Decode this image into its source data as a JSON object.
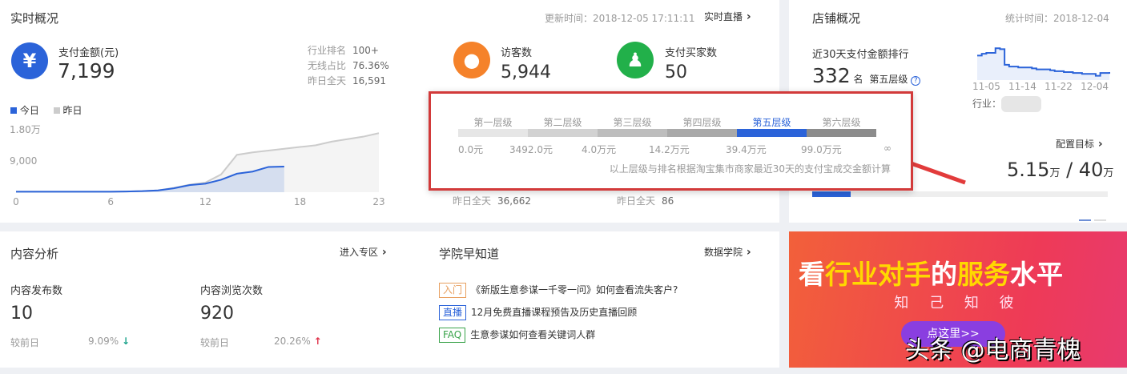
{
  "realtime": {
    "title": "实时概况",
    "update_time": "更新时间：2018-12-05 17:11:11",
    "live_link": "实时直播",
    "pay": {
      "icon": "yen-icon",
      "label": "支付金额(元)",
      "value": "7,199",
      "stats": [
        {
          "k": "行业排名",
          "v": "100+"
        },
        {
          "k": "无线占比",
          "v": "76.36%"
        },
        {
          "k": "昨日全天",
          "v": "16,591"
        }
      ]
    },
    "visitors": {
      "icon": "footprint-icon",
      "label": "访客数",
      "value": "5,944",
      "yesterday_k": "昨日全天",
      "yesterday_v": "36,662"
    },
    "buyers": {
      "icon": "users-icon",
      "label": "支付买家数",
      "value": "50",
      "yesterday_k": "昨日全天",
      "yesterday_v": "86"
    },
    "colors": {
      "blue": "#2b63d9",
      "orange": "#f5822a",
      "green": "#22b04a"
    }
  },
  "chart_data": {
    "type": "area",
    "legend": [
      "今日",
      "昨日"
    ],
    "legend_placement": "top-left",
    "y_ticks": [
      "1.80万",
      "9,000"
    ],
    "x_ticks": [
      "0",
      "6",
      "12",
      "18",
      "23"
    ],
    "ylim": [
      0,
      18000
    ],
    "xlim": [
      0,
      23
    ],
    "series": [
      {
        "name": "今日",
        "color": "#2b63d9",
        "x": [
          0,
          1,
          2,
          3,
          4,
          5,
          6,
          7,
          8,
          9,
          10,
          11,
          12,
          13,
          14,
          15,
          16,
          17
        ],
        "values": [
          150,
          150,
          150,
          150,
          150,
          150,
          150,
          200,
          300,
          500,
          1100,
          2000,
          2400,
          3500,
          5200,
          5800,
          7100,
          7199
        ]
      },
      {
        "name": "昨日",
        "color": "#cccccc",
        "x": [
          0,
          1,
          2,
          3,
          4,
          5,
          6,
          7,
          8,
          9,
          10,
          11,
          12,
          13,
          14,
          15,
          16,
          17,
          18,
          19,
          20,
          21,
          22,
          23
        ],
        "values": [
          150,
          150,
          150,
          150,
          150,
          150,
          150,
          200,
          300,
          500,
          1200,
          2100,
          2700,
          5000,
          10500,
          11200,
          11700,
          12200,
          12700,
          13200,
          14200,
          14900,
          15600,
          16591
        ]
      }
    ]
  },
  "levels": {
    "names": [
      "第一层级",
      "第二层级",
      "第三层级",
      "第四层级",
      "第五层级",
      "第六层级"
    ],
    "current": "第五层级",
    "thresholds": [
      "0.0元",
      "3492.0元",
      "4.0万元",
      "14.2万元",
      "39.4万元",
      "99.0万元",
      "∞"
    ],
    "note": "以上层级与排名根据淘宝集市商家最近30天的支付宝成交金额计算"
  },
  "store": {
    "title": "店铺概况",
    "stat_time": "统计时间：2018-12-04",
    "rank_label": "近30天支付金额排行",
    "rank": "332",
    "rank_unit": "名",
    "level": "第五层级",
    "help_icon": "question-icon",
    "spark_x": [
      "11-05",
      "11-14",
      "11-22",
      "12-04"
    ],
    "spark_values": [
      60,
      58,
      57,
      57,
      52,
      53,
      70,
      72,
      72,
      73,
      73,
      73,
      74,
      75,
      75,
      75,
      76,
      77,
      77,
      78,
      78,
      79,
      79,
      80,
      80,
      80,
      82,
      79,
      79,
      78
    ],
    "industry_label": "行业：",
    "target_link": "配置目标",
    "target_value": "5.15",
    "target_unit": "万",
    "target_total": "40",
    "progress": 0.129
  },
  "content": {
    "title": "内容分析",
    "link": "进入专区",
    "items": [
      {
        "label": "内容发布数",
        "value": "10",
        "cmp": "较前日",
        "change": "9.09%",
        "dir": "down"
      },
      {
        "label": "内容浏览次数",
        "value": "920",
        "cmp": "较前日",
        "change": "20.26%",
        "dir": "up"
      }
    ]
  },
  "academy": {
    "title": "学院早知道",
    "link": "数据学院",
    "items": [
      {
        "tag": "入门",
        "color": "#e8a060",
        "text": "《新版生意参谋一千零一问》如何查看流失客户?"
      },
      {
        "tag": "直播",
        "color": "#2b63d9",
        "text": "12月免费直播课程预告及历史直播回顾"
      },
      {
        "tag": "FAQ",
        "color": "#3aa34a",
        "text": "生意参谋如何查看关键词人群"
      }
    ]
  },
  "banner": {
    "headline_parts": [
      "看",
      "行业对手",
      "的",
      "服务",
      "水平"
    ],
    "sub": "知 己 知 彼",
    "button": "点这里>>",
    "watermark": "头条 @电商青槐"
  }
}
